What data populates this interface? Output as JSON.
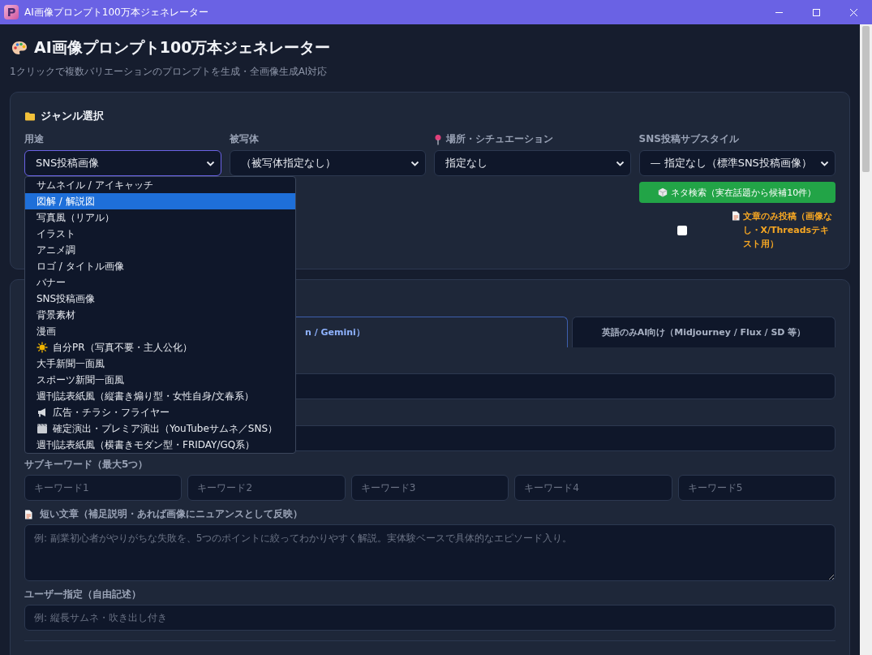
{
  "window": {
    "title": "AI画像プロンプト100万本ジェネレーター"
  },
  "header": {
    "title": "AI画像プロンプト100万本ジェネレーター",
    "subtitle": "1クリックで複数バリエーションのプロンプトを生成・全画像生成AI対応"
  },
  "genre_panel": {
    "heading": "ジャンル選択",
    "fields": [
      {
        "label": "用途",
        "value": "SNS投稿画像",
        "focused": true,
        "kind": "plain"
      },
      {
        "label": "被写体",
        "value": "（被写体指定なし）",
        "focused": false,
        "kind": "plain"
      },
      {
        "label": "場所・シチュエーション",
        "value": "指定なし",
        "focused": false,
        "kind": "pin"
      },
      {
        "label": "SNS投稿サブスタイル",
        "value": "— 指定なし（標準SNS投稿画像）",
        "focused": false,
        "kind": "plain"
      }
    ],
    "search_button": "ネタ検索（実在話題から候補10件）",
    "text_only": {
      "label": "文章のみ投稿（画像なし・X/Threadsテキスト用）",
      "checked": false
    }
  },
  "use_dropdown": {
    "options": [
      {
        "label": "サムネイル / アイキャッチ",
        "selected": false
      },
      {
        "label": "図解 / 解説図",
        "selected": true
      },
      {
        "label": "写真風（リアル）",
        "selected": false
      },
      {
        "label": "イラスト",
        "selected": false
      },
      {
        "label": "アニメ調",
        "selected": false
      },
      {
        "label": "ロゴ / タイトル画像",
        "selected": false
      },
      {
        "label": "バナー",
        "selected": false
      },
      {
        "label": "SNS投稿画像",
        "selected": false
      },
      {
        "label": "背景素材",
        "selected": false
      },
      {
        "label": "漫画",
        "selected": false
      },
      {
        "label": "自分PR（写真不要・主人公化）",
        "selected": false,
        "kind": "sun"
      },
      {
        "label": "大手新聞一面風",
        "selected": false
      },
      {
        "label": "スポーツ新聞一面風",
        "selected": false
      },
      {
        "label": "週刊誌表紙風（縦書き煽り型・女性自身/文春系）",
        "selected": false
      },
      {
        "label": "広告・チラシ・フライヤー",
        "selected": false,
        "kind": "megaphone"
      },
      {
        "label": "確定演出・プレミア演出（YouTubeサムネ／SNS）",
        "selected": false,
        "kind": "film"
      },
      {
        "label": "週刊誌表紙風（横書きモダン型・FRIDAY/GQ系）",
        "selected": false
      }
    ]
  },
  "prompt_panel": {
    "tabs": [
      {
        "label": "n / Gemini）",
        "selected": true
      },
      {
        "label": "英語のみAI向け（Midjourney / Flux / SD 等）",
        "selected": false
      }
    ],
    "sub_keywords": {
      "label": "サブキーワード（最大5つ）",
      "placeholders": [
        "キーワード1",
        "キーワード2",
        "キーワード3",
        "キーワード4",
        "キーワード5"
      ]
    },
    "short_text": {
      "label": "短い文章（補足説明・あれば画像にニュアンスとして反映）",
      "placeholder": "例: 副業初心者がやりがちな失敗を、5つのポイントに絞ってわかりやすく解説。実体験ベースで具体的なエピソード入り。"
    },
    "user_spec": {
      "label": "ユーザー指定（自由記述）",
      "placeholder": "例: 縦長サムネ・吹き出し付き"
    }
  }
}
